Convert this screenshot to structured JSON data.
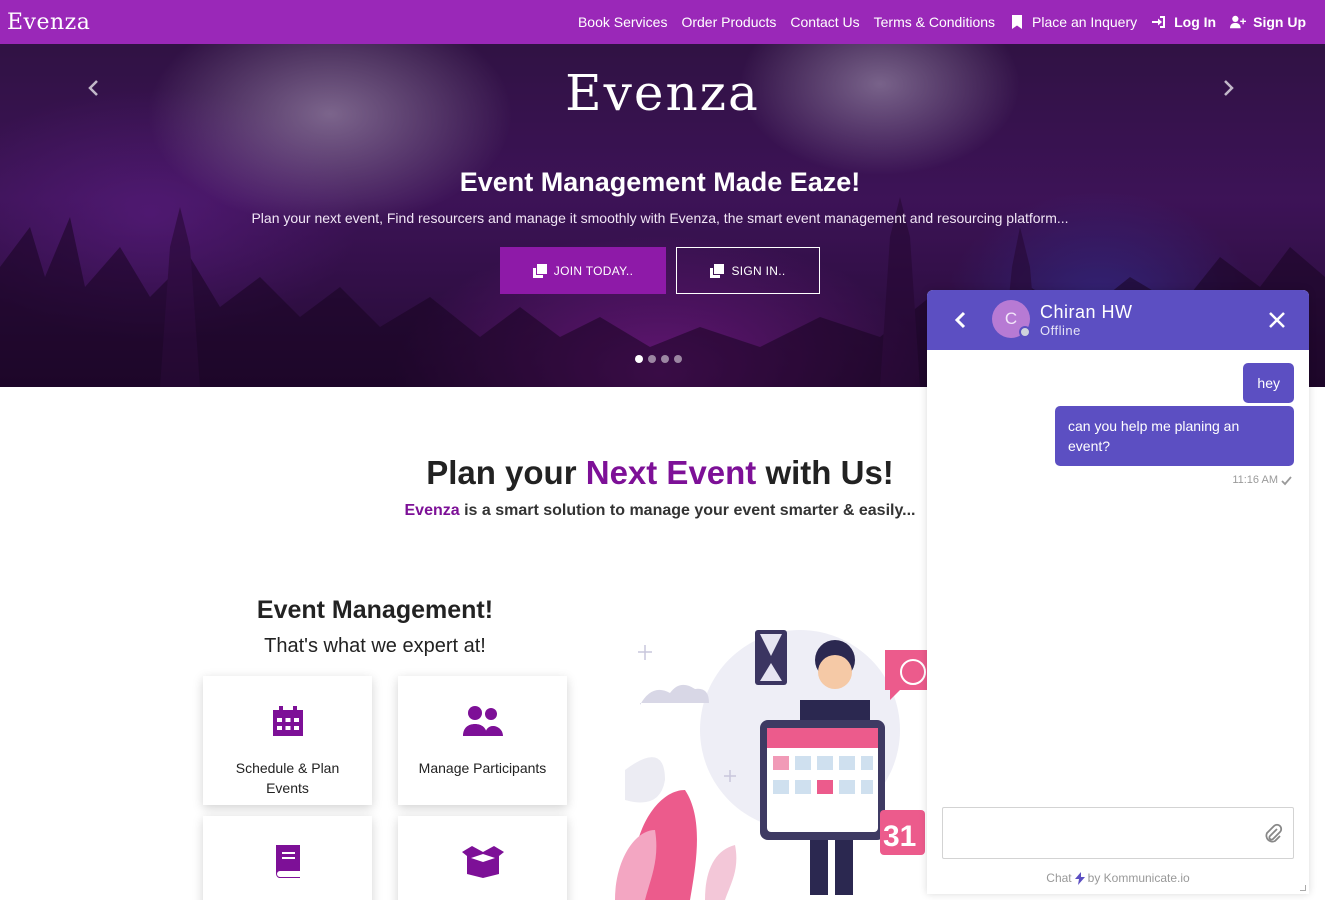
{
  "navbar": {
    "brand": "Evenza",
    "links": [
      {
        "label": "Book Services"
      },
      {
        "label": "Order Products"
      },
      {
        "label": "Contact Us"
      },
      {
        "label": "Terms & Conditions"
      },
      {
        "label": "Place an Inquery",
        "icon": "bookmark-icon"
      },
      {
        "label": "Log In",
        "icon": "login-icon"
      },
      {
        "label": "Sign Up",
        "icon": "user-plus-icon"
      }
    ]
  },
  "hero": {
    "logo": "Evenza",
    "title": "Event Management Made Eaze!",
    "subtitle": "Plan your next event, Find resourcers and manage it smoothly with Evenza, the smart event management and resourcing platform...",
    "join_label": "JOIN TODAY..",
    "sign_label": "SIGN IN..",
    "slide_count": 4,
    "active_slide": 1
  },
  "section": {
    "title_pre": "Plan your ",
    "title_accent": "Next Event",
    "title_post": " with Us!",
    "sub_accent": "Evenza",
    "sub_rest": " is a smart solution to manage your event smarter & easily...",
    "em_title": "Event Management!",
    "em_sub": "That's what we expert at!"
  },
  "cards": [
    {
      "label": "Schedule & Plan Events",
      "icon": "calendar-icon"
    },
    {
      "label": "Manage Participants",
      "icon": "users-icon"
    },
    {
      "label": "",
      "icon": "book-icon"
    },
    {
      "label": "",
      "icon": "box-icon"
    }
  ],
  "chat": {
    "name": "Chiran HW",
    "initial": "C",
    "status": "Offline",
    "messages": [
      {
        "text": "hey"
      },
      {
        "text": "can you help me planing an event?"
      }
    ],
    "time": "11:16 AM",
    "powered_chat": "Chat",
    "powered_by": "by Kommunicate.io",
    "accent": "#5c4fc2"
  },
  "colors": {
    "navbar": "#9a28b8",
    "accent": "#7d1097"
  }
}
